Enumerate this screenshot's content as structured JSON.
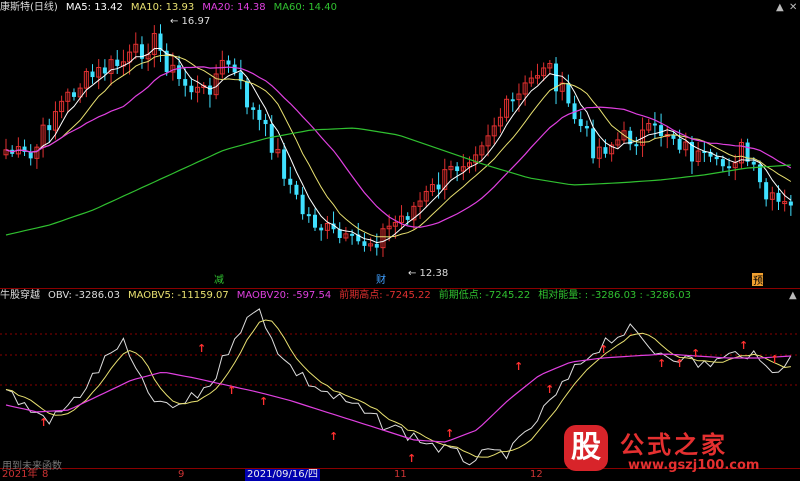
{
  "header": {
    "title": "康斯特(日线)",
    "ma5": "MA5: 13.42",
    "ma10": "MA10: 13.93",
    "ma20": "MA20: 14.38",
    "ma60": "MA60: 14.40"
  },
  "indicator": {
    "title": "牛股穿越",
    "obv": "OBV: -3286.03",
    "maobv5": "MAOBV5: -11159.07",
    "maobv20": "MAOBV20: -597.54",
    "prev_high": "前期高点: -7245.22",
    "prev_low": "前期低点: -7245.22",
    "rel_energy": "相对能量: : -3286.03 : -3286.03"
  },
  "annotations": {
    "high_label": "16.97",
    "low_label": "12.38",
    "marker_1": "减",
    "marker_2": "财",
    "marker_3": "预"
  },
  "axis": {
    "year": "2021年",
    "m8": "8",
    "m9": "9",
    "date": "2021/09/16/四",
    "m11": "11",
    "m12": "12"
  },
  "footer": {
    "note": "用到未来函数"
  },
  "watermark": {
    "seal": "股",
    "brand": "公式之家",
    "url": "www.gszj100.com"
  },
  "colors": {
    "up": "#e03030",
    "down": "#40e0ff",
    "ma5": "#ffffff",
    "ma10": "#e8e070",
    "ma20": "#e040e0",
    "ma60": "#30c030"
  },
  "chart_data": [
    {
      "type": "candlestick",
      "title": "康斯特(日线)",
      "ylim": [
        12.0,
        17.2
      ],
      "max_label": 16.97,
      "min_label": 12.38,
      "series": [
        {
          "name": "MA5"
        },
        {
          "name": "MA10"
        },
        {
          "name": "MA20"
        },
        {
          "name": "MA60"
        }
      ]
    },
    {
      "type": "line",
      "title": "牛股穿越",
      "series": [
        {
          "name": "OBV"
        },
        {
          "name": "MAOBV5"
        },
        {
          "name": "MAOBV20"
        }
      ]
    }
  ]
}
